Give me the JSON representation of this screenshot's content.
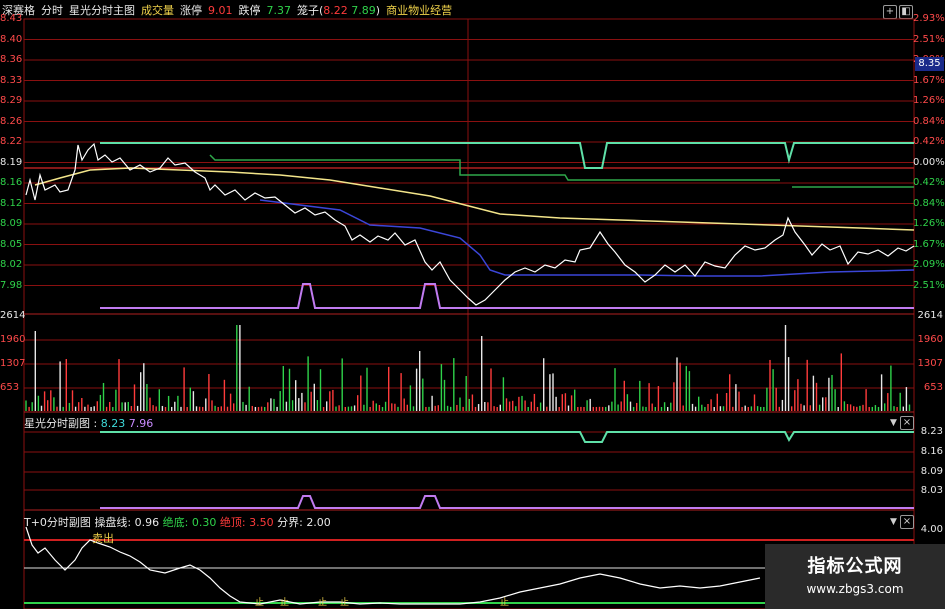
{
  "header": {
    "board": "深赛格",
    "mode": "分时",
    "indicator_main": "星光分时主图",
    "volume": "成交量",
    "limit_up_label": "涨停",
    "limit_up_value": "9.01",
    "limit_down_label": "跌停",
    "limit_down_value": "7.37",
    "cage_label": "笼子(",
    "cage_high": "8.22",
    "cage_low": "7.89",
    "cage_close": ")",
    "industry": "商业物业经营"
  },
  "main_chart": {
    "left_axis": [
      "8.43",
      "8.40",
      "8.36",
      "8.33",
      "8.29",
      "8.26",
      "8.22",
      "8.19",
      "8.16",
      "8.12",
      "8.09",
      "8.05",
      "8.02",
      "7.98"
    ],
    "right_axis": [
      "2.93%",
      "2.51%",
      "2.09%",
      "1.67%",
      "1.26%",
      "0.84%",
      "0.42%",
      "0.00%",
      "0.42%",
      "0.84%",
      "1.26%",
      "1.67%",
      "2.09%",
      "2.51%"
    ],
    "current_price": "8.35",
    "colors": {
      "price_line": "#ffffff",
      "avg_line": "#f3e58a",
      "upper_band": "#5fe0a8",
      "lower_band": "#c07bf0",
      "blue_line": "#3b46d8",
      "grid": "#8a1010"
    }
  },
  "volume_chart": {
    "left_axis": [
      "2614",
      "1960",
      "1307",
      "653"
    ],
    "right_axis": [
      "2614",
      "1960",
      "1307",
      "653"
    ]
  },
  "sub_chart": {
    "title": "星光分时副图",
    "value1": "8.23",
    "value2": "7.96",
    "right_axis": [
      "8.23",
      "8.16",
      "8.09",
      "8.03"
    ]
  },
  "t0_chart": {
    "title": "T+0分时副图",
    "op_label": "操盘线:",
    "op_value": "0.96",
    "bottom_label": "绝底:",
    "bottom_value": "0.30",
    "top_label": "绝顶:",
    "top_value": "3.50",
    "divide_label": "分界:",
    "divide_value": "2.00",
    "sell_label": "卖出",
    "buy_marks": [
      "止",
      "止",
      "止",
      "止",
      "止"
    ],
    "right_axis": [
      "4.00"
    ]
  },
  "watermark": {
    "title": "指标公式网",
    "url": "www.zbgs3.com"
  }
}
